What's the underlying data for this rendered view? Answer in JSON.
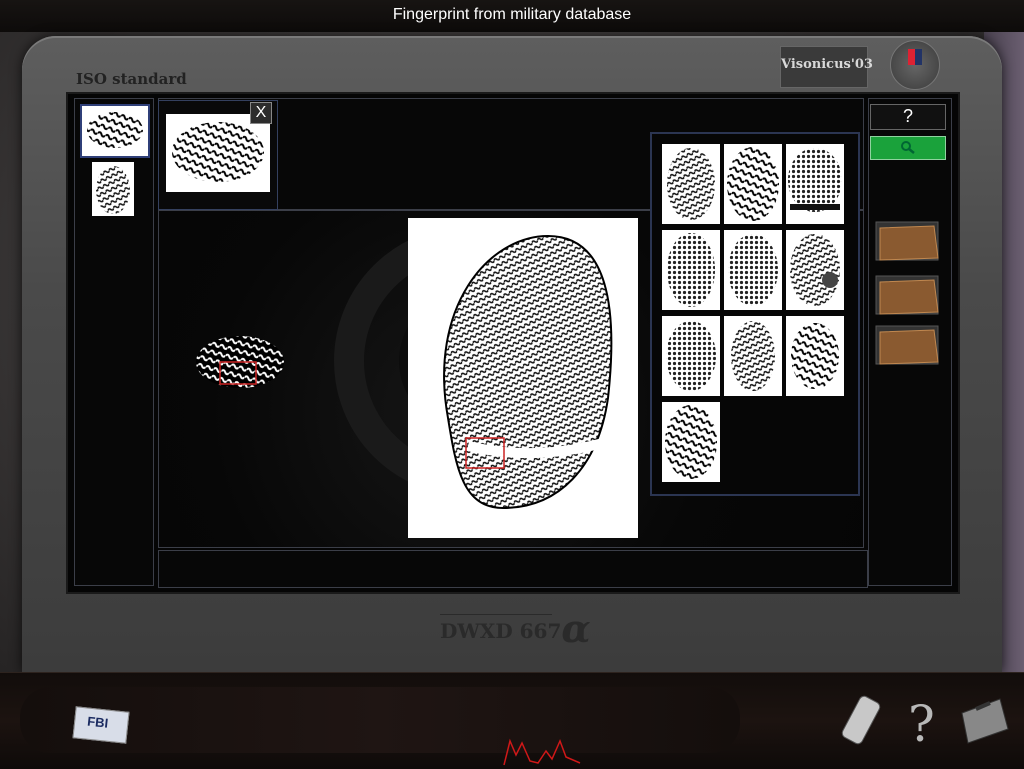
{
  "header": {
    "title": "Fingerprint from military database"
  },
  "monitor": {
    "standard_label": "ISO standard",
    "brand": "Visonicus'03",
    "model_text": "DWXD 667",
    "model_suffix": "α"
  },
  "tray": {
    "close_label": "X"
  },
  "sidebar": {
    "help_label": "?"
  },
  "inventory": {
    "badge_text": "FBI"
  },
  "icons": {
    "close": "close-icon",
    "search": "magnifier-icon",
    "help": "question-mark-icon",
    "folder": "folder-icon",
    "phone": "phone-icon",
    "case": "briefcase-icon"
  },
  "colors": {
    "search_button": "#1aa23b",
    "selection_frame": "#cc2222",
    "panel_border": "#2b3552"
  }
}
